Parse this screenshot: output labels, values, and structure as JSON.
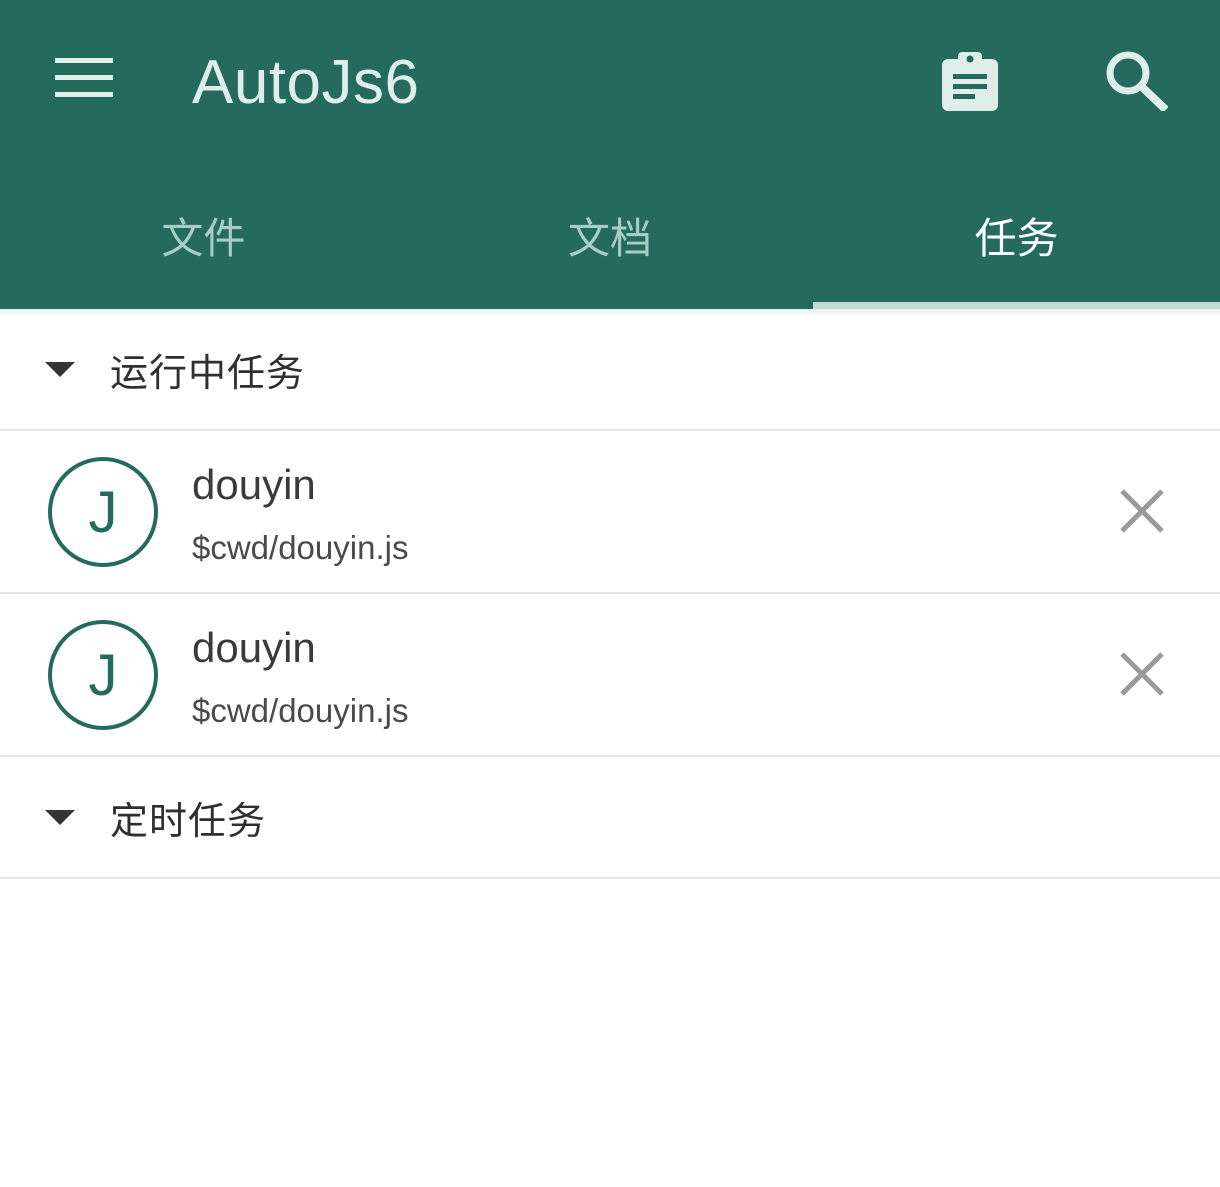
{
  "app": {
    "title": "AutoJs6",
    "colors": {
      "primary": "#246b5e",
      "tab_inactive": "#a8cdc5",
      "tab_active": "#ffffff"
    }
  },
  "toolbar": {
    "menu_icon": "hamburger-menu-icon",
    "clipboard_icon": "clipboard-icon",
    "search_icon": "search-icon"
  },
  "tabs": [
    {
      "label": "文件",
      "active": false
    },
    {
      "label": "文档",
      "active": false
    },
    {
      "label": "任务",
      "active": true
    }
  ],
  "sections": {
    "running": {
      "title": "运行中任务",
      "tasks": [
        {
          "avatar_letter": "J",
          "name": "douyin",
          "path": "$cwd/douyin.js"
        },
        {
          "avatar_letter": "J",
          "name": "douyin",
          "path": "$cwd/douyin.js"
        }
      ]
    },
    "scheduled": {
      "title": "定时任务"
    }
  }
}
